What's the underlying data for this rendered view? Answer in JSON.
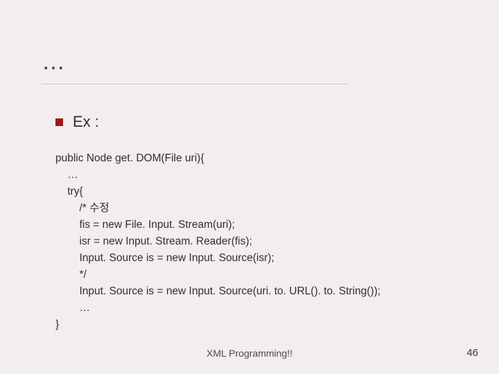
{
  "title": "…",
  "bullet_label": "Ex :",
  "code_lines": [
    "public Node get. DOM(File uri){",
    "    …",
    "    try{",
    "        /* 수정",
    "        fis = new File. Input. Stream(uri);",
    "        isr = new Input. Stream. Reader(fis);",
    "        Input. Source is = new Input. Source(isr);",
    "        */",
    "        Input. Source is = new Input. Source(uri. to. URL(). to. String());",
    "        …",
    "}"
  ],
  "footer": "XML Programming!!",
  "page_number": "46"
}
